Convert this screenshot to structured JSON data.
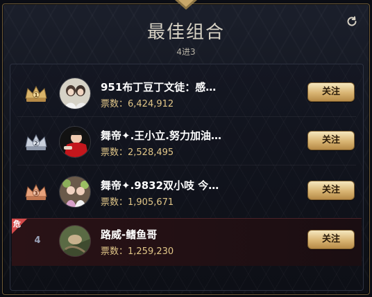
{
  "header": {
    "title": "最佳组合",
    "subtitle": "4进3"
  },
  "colors": {
    "gold": "#e1c688",
    "danger": "#d44a4a",
    "button_gradient_top": "#f5e7bf",
    "button_gradient_bottom": "#b68a47"
  },
  "rows": [
    {
      "rank": "1",
      "name": "951布丁豆丁文徒：感…",
      "votes": "票数：6,424,912",
      "follow": "关注",
      "crown": "gold-crown-icon"
    },
    {
      "rank": "2",
      "name": "舞帝✦.王小立.努力加油…",
      "votes": "票数：2,528,495",
      "follow": "关注",
      "crown": "silver-crown-icon"
    },
    {
      "rank": "3",
      "name": "舞帝✦.9832双小吱 今…",
      "votes": "票数：1,905,671",
      "follow": "关注",
      "crown": "bronze-crown-icon"
    },
    {
      "rank": "4",
      "name": "路威-鳍鱼哥",
      "votes": "票数：1,259,230",
      "follow": "关注",
      "danger_label": "危"
    }
  ]
}
